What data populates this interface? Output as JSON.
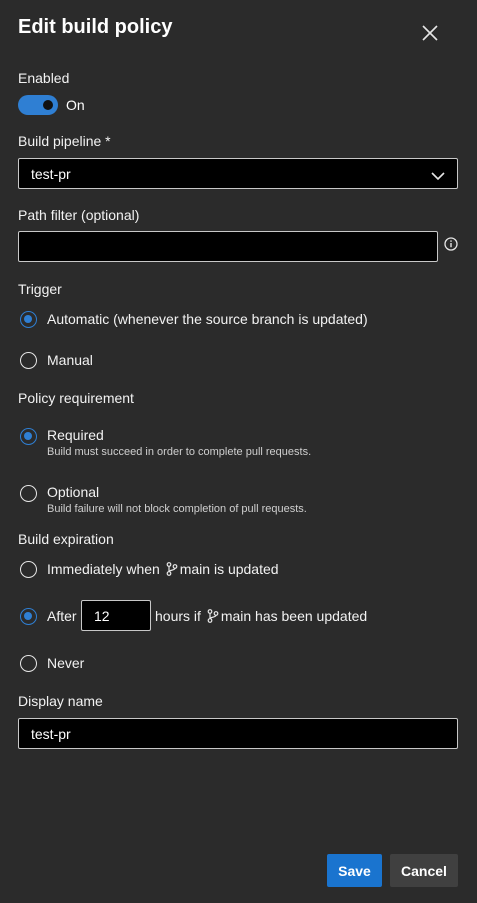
{
  "dialog": {
    "title": "Edit build policy"
  },
  "enabled": {
    "label": "Enabled",
    "state_text": "On",
    "value": true
  },
  "build_pipeline": {
    "label": "Build pipeline *",
    "selected": "test-pr"
  },
  "path_filter": {
    "label": "Path filter (optional)",
    "value": ""
  },
  "trigger": {
    "label": "Trigger",
    "options": [
      {
        "label": "Automatic (whenever the source branch is updated)",
        "selected": true
      },
      {
        "label": "Manual",
        "selected": false
      }
    ]
  },
  "policy_requirement": {
    "label": "Policy requirement",
    "options": [
      {
        "label": "Required",
        "description": "Build must succeed in order to complete pull requests.",
        "selected": true
      },
      {
        "label": "Optional",
        "description": "Build failure will not block completion of pull requests.",
        "selected": false
      }
    ]
  },
  "build_expiration": {
    "label": "Build expiration",
    "immediately": {
      "prefix": "Immediately when",
      "suffix": "main is updated",
      "selected": false
    },
    "after": {
      "prefix": "After",
      "hours": "12",
      "suffix_a": "hours if",
      "suffix_b": "main has been updated",
      "selected": true
    },
    "never": {
      "label": "Never",
      "selected": false
    }
  },
  "display_name": {
    "label": "Display name",
    "value": "test-pr"
  },
  "footer": {
    "save_label": "Save",
    "cancel_label": "Cancel"
  },
  "colors": {
    "accent": "#2f7fd3",
    "primary_button": "#1a74cf",
    "background": "#2b2b2b"
  },
  "icons": {
    "close": "close-icon",
    "chevron": "chevron-down-icon",
    "info": "info-icon",
    "branch": "branch-icon"
  }
}
